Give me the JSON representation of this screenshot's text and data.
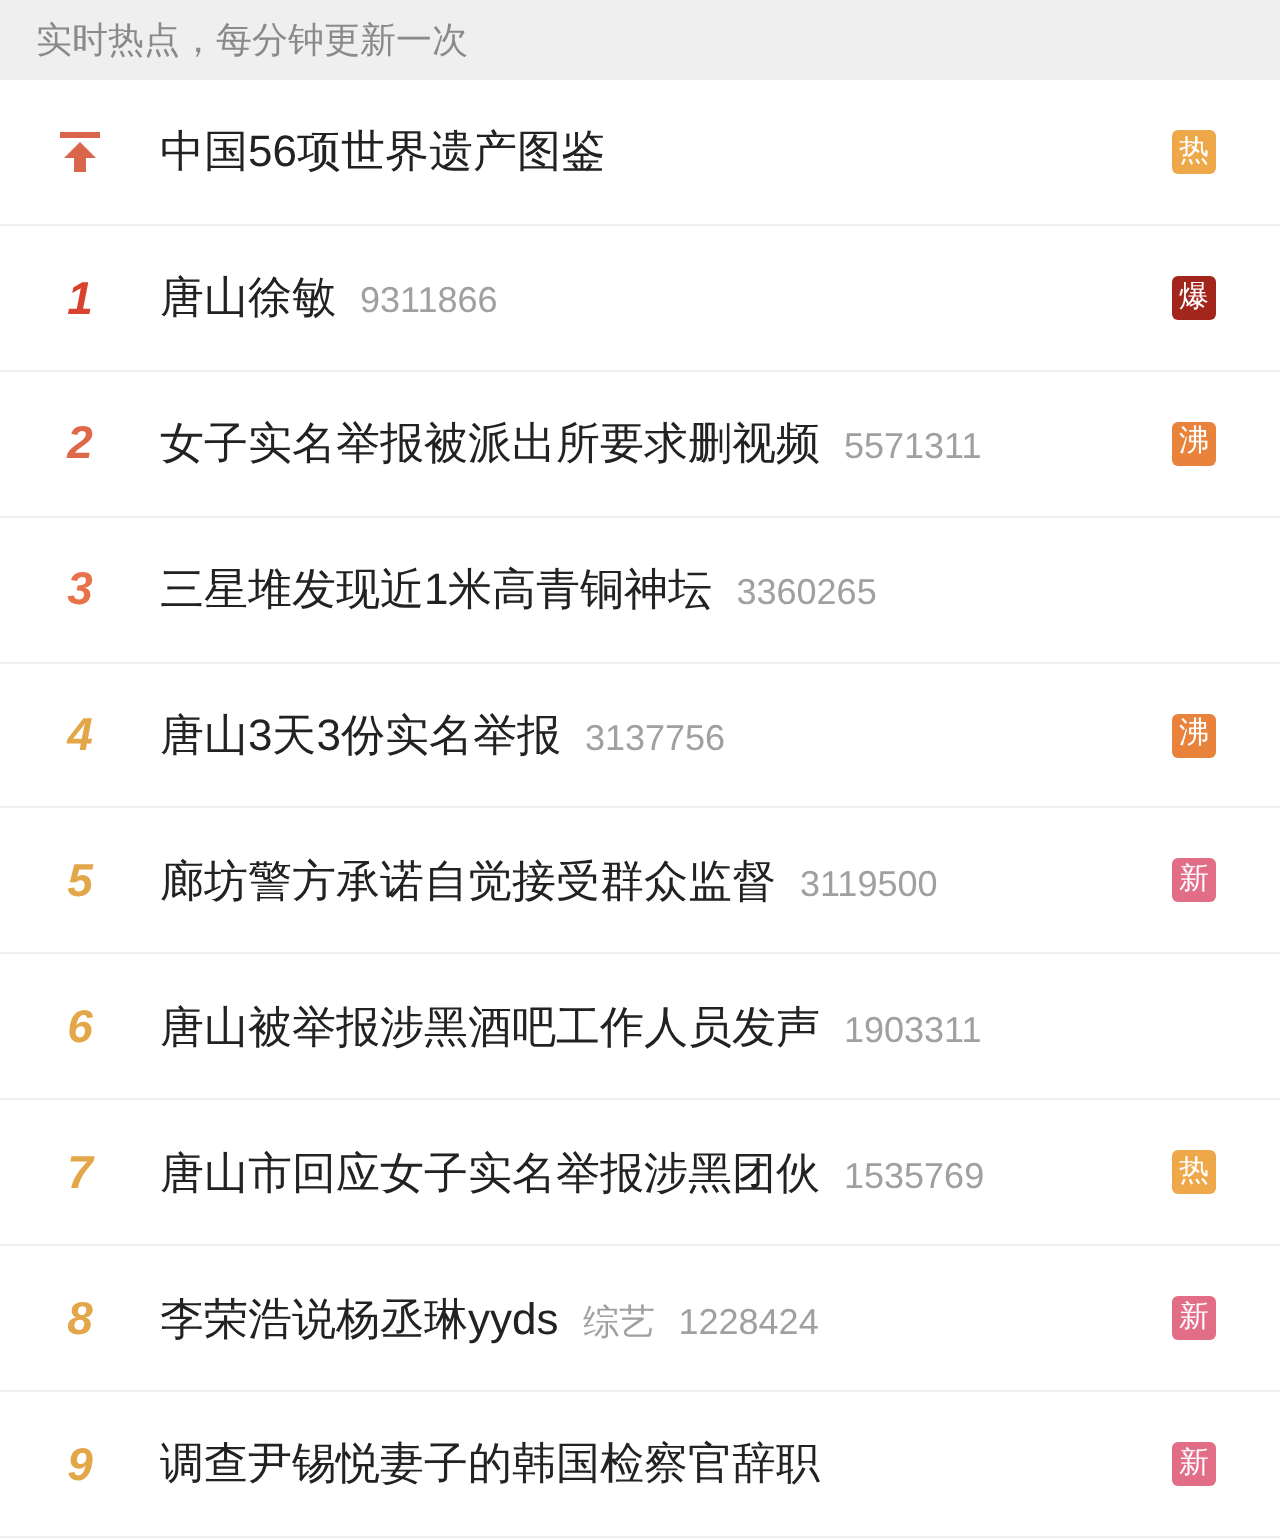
{
  "header": {
    "title": "实时热点，每分钟更新一次"
  },
  "items": [
    {
      "kind": "pinned",
      "title": "中国56项世界遗产图鉴",
      "badge": {
        "text": "热",
        "kind": "hot"
      }
    },
    {
      "kind": "ranked",
      "rank": "1",
      "color": "#d8432f",
      "title": "唐山徐敏",
      "count": "9311866",
      "badge": {
        "text": "爆",
        "kind": "boom"
      }
    },
    {
      "kind": "ranked",
      "rank": "2",
      "color": "#e0684a",
      "title": "女子实名举报被派出所要求删视频",
      "count": "5571311",
      "badge": {
        "text": "沸",
        "kind": "boil"
      }
    },
    {
      "kind": "ranked",
      "rank": "3",
      "color": "#e8734a",
      "title": "三星堆发现近1米高青铜神坛",
      "count": "3360265"
    },
    {
      "kind": "ranked",
      "rank": "4",
      "color": "#e3a74a",
      "title": "唐山3天3份实名举报",
      "count": "3137756",
      "badge": {
        "text": "沸",
        "kind": "boil"
      }
    },
    {
      "kind": "ranked",
      "rank": "5",
      "color": "#e3a74a",
      "title": "廊坊警方承诺自觉接受群众监督",
      "count": "3119500",
      "badge": {
        "text": "新",
        "kind": "new"
      }
    },
    {
      "kind": "ranked",
      "rank": "6",
      "color": "#e3a74a",
      "title": "唐山被举报涉黑酒吧工作人员发声",
      "count": "1903311"
    },
    {
      "kind": "ranked",
      "rank": "7",
      "color": "#e3a74a",
      "title": "唐山市回应女子实名举报涉黑团伙",
      "count": "1535769",
      "badge": {
        "text": "热",
        "kind": "hot"
      }
    },
    {
      "kind": "ranked",
      "rank": "8",
      "color": "#e3a74a",
      "title": "李荣浩说杨丞琳yyds",
      "category": "综艺",
      "count": "1228424",
      "badge": {
        "text": "新",
        "kind": "new"
      }
    },
    {
      "kind": "ranked",
      "rank": "9",
      "color": "#e3a74a",
      "title": "调查尹锡悦妻子的韩国检察官辞职",
      "badge": {
        "text": "新",
        "kind": "new"
      }
    }
  ]
}
